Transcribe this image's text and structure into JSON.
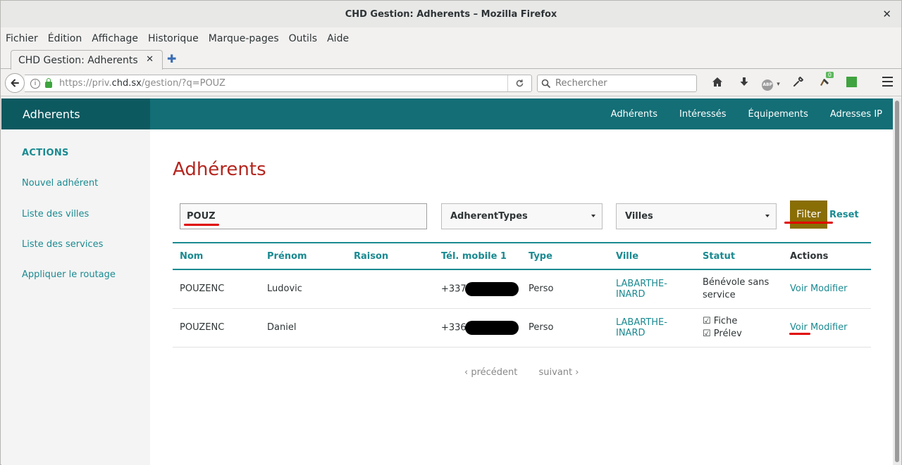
{
  "window": {
    "title": "CHD Gestion: Adherents – Mozilla Firefox",
    "close_glyph": "✕"
  },
  "menu": [
    "Fichier",
    "Édition",
    "Affichage",
    "Historique",
    "Marque-pages",
    "Outils",
    "Aide"
  ],
  "tab": {
    "title": "CHD Gestion: Adherents",
    "close_glyph": "✕",
    "new_glyph": "✚"
  },
  "navbar": {
    "url_prefix": "https://priv.",
    "url_domain": "chd.sx",
    "url_path": "/gestion/?q=POUZ",
    "search_placeholder": "Rechercher",
    "addon_badge": "0",
    "abp_label": "ABP"
  },
  "app": {
    "brand": "Adherents",
    "nav": [
      "Adhérents",
      "Intéressés",
      "Équipements",
      "Adresses IP"
    ]
  },
  "sidebar": {
    "heading": "ACTIONS",
    "links": [
      "Nouvel adhérent",
      "Liste des villes",
      "Liste des services",
      "Appliquer le routage"
    ]
  },
  "page": {
    "title": "Adhérents",
    "query": "POUZ",
    "type_select": "AdherentTypes",
    "city_select": "Villes",
    "filter_label": "Filter",
    "reset_label": "Reset"
  },
  "table": {
    "headers": [
      "Nom",
      "Prénom",
      "Raison",
      "Tél. mobile 1",
      "Type",
      "Ville",
      "Statut",
      "Actions"
    ],
    "rows": [
      {
        "nom": "POUZENC",
        "prenom": "Ludovic",
        "raison": "",
        "tel": "+337",
        "type": "Perso",
        "ville": "LABARTHE-INARD",
        "statut": [
          "Bénévole sans",
          "service"
        ],
        "voir": "Voir",
        "modifier": "Modifier"
      },
      {
        "nom": "POUZENC",
        "prenom": "Daniel",
        "raison": "",
        "tel": "+336",
        "type": "Perso",
        "ville": "LABARTHE-INARD",
        "statut": [
          "☑ Fiche",
          "☑ Prélev"
        ],
        "voir": "Voir",
        "modifier": "Modifier"
      }
    ]
  },
  "pager": {
    "prev": "‹ précédent",
    "next": "suivant ›"
  },
  "colors": {
    "teal": "#136e76",
    "teal_dark": "#0d5960",
    "link": "#1a8a91",
    "title_red": "#b5261f",
    "filter_btn": "#896d05",
    "annotation_red": "#e00000"
  }
}
